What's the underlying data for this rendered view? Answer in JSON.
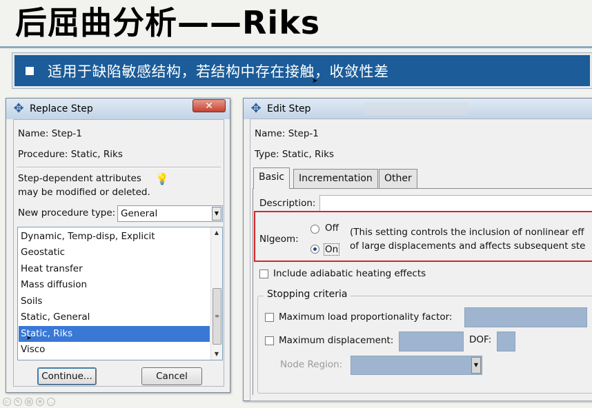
{
  "slide": {
    "title": "后屈曲分析——Riks",
    "bullet_text": "适用于缺陷敏感结构，若结构中存在接触，收敛性差"
  },
  "replace_step": {
    "title": "Replace Step",
    "close_icon": "close-icon",
    "name_label": "Name:",
    "name_value": "Step-1",
    "procedure_label": "Procedure:",
    "procedure_value": "Static, Riks",
    "note_line1": "Step-dependent attributes",
    "note_line2": "may be modified or deleted.",
    "procedure_type_label": "New procedure type:",
    "procedure_type_value": "General",
    "procedures": [
      {
        "label": "Dynamic, Temp-disp, Explicit",
        "selected": false
      },
      {
        "label": "Geostatic",
        "selected": false
      },
      {
        "label": "Heat transfer",
        "selected": false
      },
      {
        "label": "Mass diffusion",
        "selected": false
      },
      {
        "label": "Soils",
        "selected": false
      },
      {
        "label": "Static, General",
        "selected": false
      },
      {
        "label": "Static, Riks",
        "selected": true
      },
      {
        "label": "Visco",
        "selected": false
      }
    ],
    "continue_label": "Continue...",
    "cancel_label": "Cancel"
  },
  "edit_step": {
    "title": "Edit Step",
    "name_label": "Name:",
    "name_value": "Step-1",
    "type_label": "Type:",
    "type_value": "Static, Riks",
    "tabs": [
      {
        "label": "Basic",
        "active": true
      },
      {
        "label": "Incrementation",
        "active": false
      },
      {
        "label": "Other",
        "active": false
      }
    ],
    "description_label": "Description:",
    "description_value": "",
    "nlgeom_label": "Nlgeom:",
    "off_label": "Off",
    "on_label": "On",
    "nlgeom_selected": "On",
    "nlgeom_help_line1": "(This setting controls the inclusion of nonlinear eff",
    "nlgeom_help_line2": "of large displacements and affects subsequent ste",
    "adiabatic_label": "Include adiabatic heating effects",
    "stopping_label": "Stopping criteria",
    "max_lpf_label": "Maximum load proportionality factor:",
    "max_disp_label": "Maximum displacement:",
    "dof_label": "DOF:",
    "node_region_label": "Node Region:"
  },
  "colors": {
    "banner": "#1b5c99",
    "selection": "#3a78d6",
    "highlight_box": "#d3262a"
  }
}
